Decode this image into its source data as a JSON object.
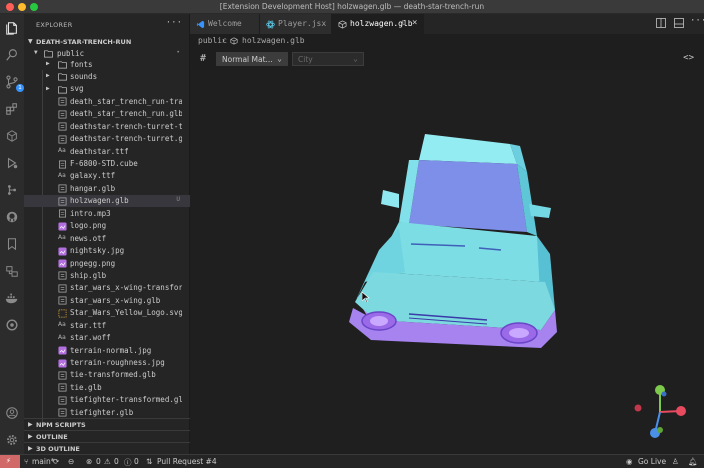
{
  "window": {
    "title": "[Extension Development Host] holzwagen.glb — death-star-trench-run"
  },
  "activity_bar": {
    "items": [
      {
        "name": "explorer-icon"
      },
      {
        "name": "search-icon"
      },
      {
        "name": "source-control-icon",
        "badge": "1"
      },
      {
        "name": "extensions-icon"
      },
      {
        "name": "cube-icon"
      },
      {
        "name": "run-debug-icon"
      },
      {
        "name": "git-graph-icon"
      },
      {
        "name": "github-icon"
      },
      {
        "name": "bookmark-icon"
      },
      {
        "name": "remote-explorer-icon"
      },
      {
        "name": "docker-icon"
      },
      {
        "name": "openai-icon"
      }
    ],
    "bottom": [
      {
        "name": "account-icon"
      },
      {
        "name": "settings-gear-icon"
      }
    ]
  },
  "sidebar": {
    "header": "EXPLORER",
    "more": "···",
    "root": "DEATH-STAR-TRENCH-RUN",
    "folder": "public",
    "items": [
      {
        "label": "fonts",
        "type": "folder"
      },
      {
        "label": "sounds",
        "type": "folder"
      },
      {
        "label": "svg",
        "type": "folder"
      },
      {
        "label": "death_star_trench_run-transformed...",
        "type": "glb"
      },
      {
        "label": "death_star_trench_run.glb",
        "type": "glb"
      },
      {
        "label": "deathstar-trench-turret-transfor...",
        "type": "glb"
      },
      {
        "label": "deathstar-trench-turret.glb",
        "type": "glb"
      },
      {
        "label": "deathstar.ttf",
        "type": "font"
      },
      {
        "label": "F-6800-STD.cube",
        "type": "file"
      },
      {
        "label": "galaxy.ttf",
        "type": "font"
      },
      {
        "label": "hangar.glb",
        "type": "glb"
      },
      {
        "label": "holzwagen.glb",
        "type": "glb",
        "selected": true,
        "mod": "U"
      },
      {
        "label": "intro.mp3",
        "type": "file"
      },
      {
        "label": "logo.png",
        "type": "image"
      },
      {
        "label": "news.otf",
        "type": "font"
      },
      {
        "label": "nightsky.jpg",
        "type": "image"
      },
      {
        "label": "pngegg.png",
        "type": "image"
      },
      {
        "label": "ship.glb",
        "type": "glb"
      },
      {
        "label": "star_wars_x-wing-transformed.glb",
        "type": "glb"
      },
      {
        "label": "star_wars_x-wing.glb",
        "type": "glb"
      },
      {
        "label": "Star_Wars_Yellow_Logo.svg",
        "type": "svg"
      },
      {
        "label": "star.ttf",
        "type": "font"
      },
      {
        "label": "star.woff",
        "type": "font"
      },
      {
        "label": "terrain-normal.jpg",
        "type": "image"
      },
      {
        "label": "terrain-roughness.jpg",
        "type": "image"
      },
      {
        "label": "tie-transformed.glb",
        "type": "glb"
      },
      {
        "label": "tie.glb",
        "type": "glb"
      },
      {
        "label": "tiefighter-transformed.glb",
        "type": "glb"
      },
      {
        "label": "tiefighter.glb",
        "type": "glb"
      }
    ],
    "sections": [
      "NPM SCRIPTS",
      "OUTLINE",
      "3D OUTLINE"
    ]
  },
  "tabs": [
    {
      "label": "Welcome",
      "icon": "vscode-icon"
    },
    {
      "label": "Player.jsx",
      "icon": "react-icon"
    },
    {
      "label": "holzwagen.glb",
      "icon": "cube-icon",
      "active": true,
      "mod": "U",
      "close": "×"
    }
  ],
  "breadcrumb": {
    "parts": [
      "public",
      "holzwagen.glb"
    ],
    "separator": "›"
  },
  "toolbar": {
    "hash": "#",
    "material_select": "Normal Mat...",
    "environment_select": "City",
    "code_toggle": "<>"
  },
  "statusbar": {
    "branch": "main*",
    "errors": "0",
    "warnings": "0",
    "info": "0",
    "pull_request": "Pull Request #4",
    "go_live": "Go Live",
    "colors": {
      "remote": "#d16969"
    }
  },
  "colors": {
    "car_top": "#8fe7f0",
    "car_body": "#6fd9e6",
    "car_front": "#7ad6dd",
    "car_windshield": "#7d8fe8",
    "car_bumper": "#a77ff0",
    "gizmo_x": "#e84a5f",
    "gizmo_y": "#7cc94b",
    "gizmo_z": "#4a8fe8"
  }
}
